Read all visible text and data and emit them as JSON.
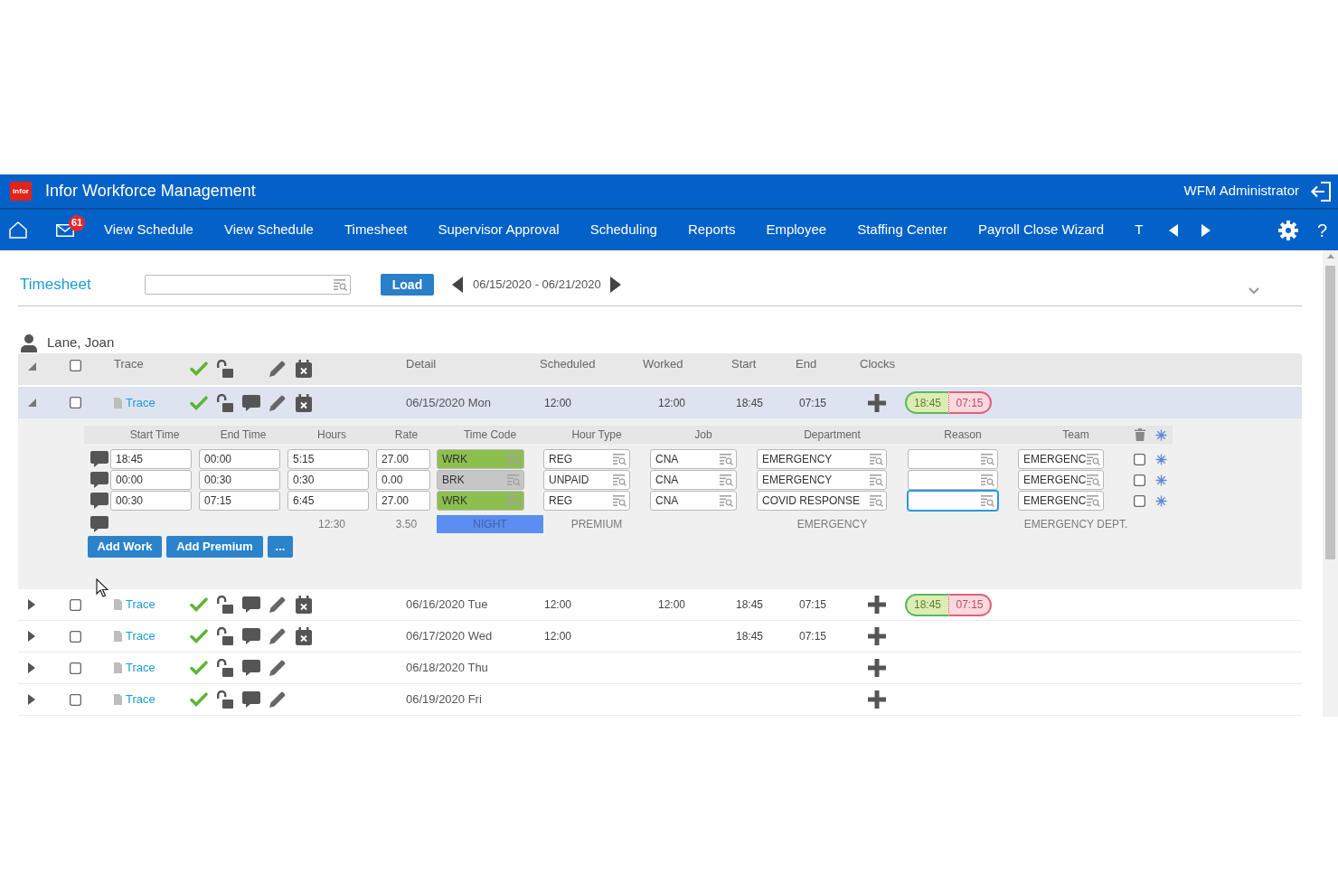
{
  "app": {
    "logo_text": "infor",
    "title": "Infor Workforce Management",
    "user": "WFM Administrator"
  },
  "nav": {
    "mail_badge": "61",
    "items": [
      "View Schedule",
      "View Schedule",
      "Timesheet",
      "Supervisor Approval",
      "Scheduling",
      "Reports",
      "Employee",
      "Staffing Center",
      "Payroll Close Wizard",
      "T"
    ],
    "help": "?"
  },
  "toolbar": {
    "title": "Timesheet",
    "load_button": "Load",
    "date_range": "06/15/2020 - 06/21/2020"
  },
  "employee": {
    "name": "Lane, Joan"
  },
  "table": {
    "columns": {
      "trace": "Trace",
      "detail": "Detail",
      "scheduled": "Scheduled",
      "worked": "Worked",
      "start": "Start",
      "end": "End",
      "clocks": "Clocks"
    },
    "select_all_checked": false,
    "rows": [
      {
        "trace": "Trace",
        "date": "06/15/2020 Mon",
        "selected": true,
        "expanded": true,
        "checked": false,
        "approved": true,
        "locked": false,
        "comment": true,
        "schedule_cancel": true,
        "scheduled": "12:00",
        "worked": "12:00",
        "start": "18:45",
        "end": "07:15",
        "clocks": [
          {
            "in": "18:45",
            "out": "07:15"
          }
        ],
        "details": {
          "columns": [
            "Start Time",
            "End Time",
            "Hours",
            "Rate",
            "Time Code",
            "Hour Type",
            "Job",
            "Department",
            "Reason",
            "Team"
          ],
          "entries": [
            {
              "start_time": "18:45",
              "end_time": "00:00",
              "hours": "5:15",
              "rate": "27.00",
              "time_code": {
                "value": "WRK",
                "color": "#8dbf4f"
              },
              "hour_type": "REG",
              "job": "CNA",
              "department": "EMERGENCY",
              "reason_focused": false,
              "team": "EMERGENC",
              "checked": false
            },
            {
              "start_time": "00:00",
              "end_time": "00:30",
              "hours": "0:30",
              "rate": "0.00",
              "time_code": {
                "value": "BRK",
                "color": "#c6c6c6"
              },
              "hour_type": "UNPAID",
              "job": "CNA",
              "department": "EMERGENCY",
              "reason_focused": false,
              "team": "EMERGENC",
              "checked": false
            },
            {
              "start_time": "00:30",
              "end_time": "07:15",
              "hours": "6:45",
              "rate": "27.00",
              "time_code": {
                "value": "WRK",
                "color": "#8dbf4f"
              },
              "hour_type": "REG",
              "job": "CNA",
              "department": "COVID RESPONSE",
              "reason_focused": true,
              "team": "EMERGENC",
              "checked": false
            }
          ],
          "totals": {
            "hours": "12:30",
            "rate": "3.50",
            "time_code": {
              "value": "NIGHT",
              "color": "#5b8ef0"
            },
            "hour_type": "PREMIUM",
            "department": "EMERGENCY",
            "team": "EMERGENCY DEPT."
          },
          "buttons": [
            "Add Work",
            "Add Premium",
            "..."
          ]
        }
      },
      {
        "trace": "Trace",
        "date": "06/16/2020 Tue",
        "selected": false,
        "expanded": false,
        "checked": false,
        "approved": true,
        "locked": false,
        "comment": true,
        "schedule_cancel": true,
        "scheduled": "12:00",
        "worked": "12:00",
        "start": "18:45",
        "end": "07:15",
        "clocks": [
          {
            "in": "18:45",
            "out": "07:15"
          }
        ]
      },
      {
        "trace": "Trace",
        "date": "06/17/2020 Wed",
        "selected": false,
        "expanded": false,
        "checked": false,
        "approved": true,
        "locked": false,
        "comment": true,
        "schedule_cancel": true,
        "scheduled": "12:00",
        "start": "18:45",
        "end": "07:15"
      },
      {
        "trace": "Trace",
        "date": "06/18/2020 Thu",
        "selected": false,
        "expanded": false,
        "checked": false,
        "approved": true,
        "locked": false,
        "comment": true,
        "schedule_cancel": false
      },
      {
        "trace": "Trace",
        "date": "06/19/2020 Fri",
        "selected": false,
        "expanded": false,
        "checked": false,
        "approved": true,
        "locked": false,
        "comment": true,
        "schedule_cancel": false
      }
    ]
  }
}
